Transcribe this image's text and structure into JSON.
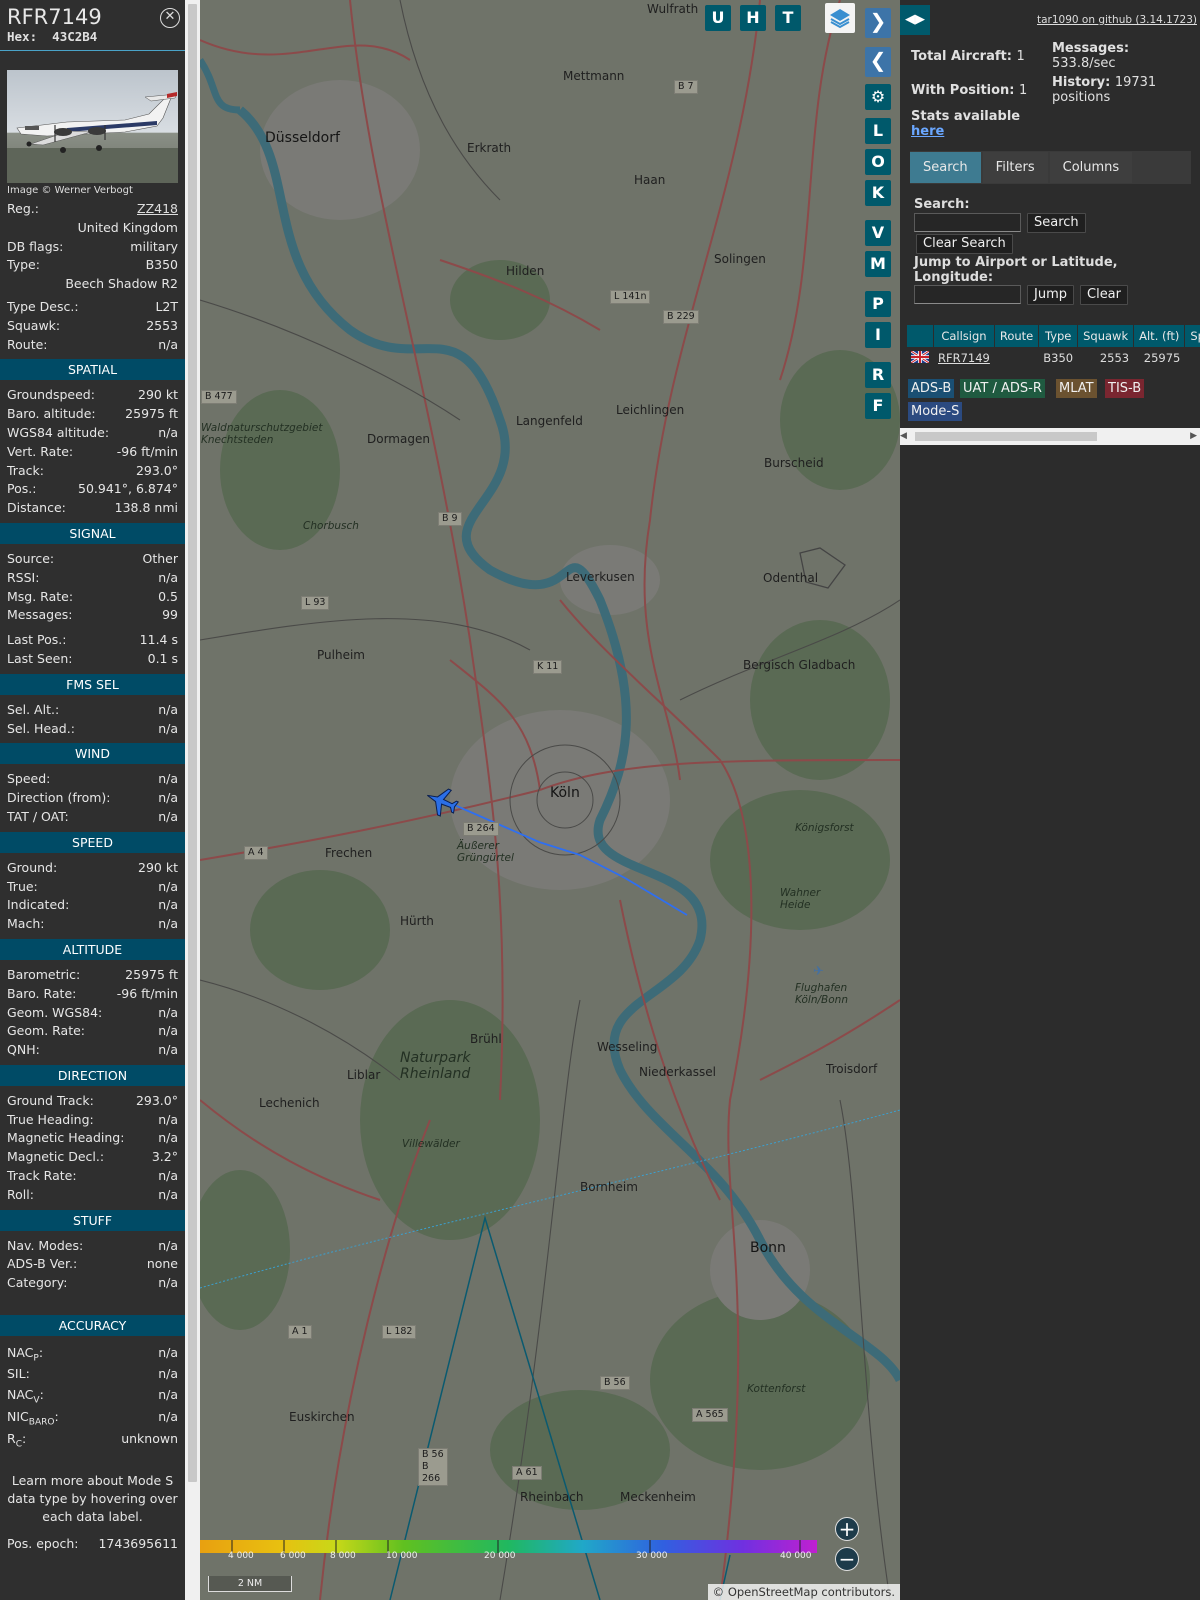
{
  "aircraft": {
    "callsign": "RFR7149",
    "hex_label": "Hex:",
    "hex": "43C2B4",
    "close_icon": "close-icon",
    "photo_credit": "Image © Werner Verbogt",
    "reg_label": "Reg.:",
    "reg": "ZZ418",
    "country": "United Kingdom",
    "dbflags_label": "DB flags:",
    "dbflags": "military",
    "type_label": "Type:",
    "type": "B350",
    "type_name": "Beech Shadow R2",
    "typedesc_label": "Type Desc.:",
    "typedesc": "L2T",
    "squawk_label": "Squawk:",
    "squawk": "2553",
    "route_label": "Route:",
    "route": "n/a"
  },
  "spatial": {
    "title": "SPATIAL",
    "rows": [
      {
        "label": "Groundspeed:",
        "value": "290 kt"
      },
      {
        "label": "Baro. altitude:",
        "value": "25975 ft"
      },
      {
        "label": "WGS84 altitude:",
        "value": "n/a"
      },
      {
        "label": "Vert. Rate:",
        "value": "-96 ft/min"
      },
      {
        "label": "Track:",
        "value": "293.0°"
      },
      {
        "label": "Pos.:",
        "value": "50.941°, 6.874°"
      },
      {
        "label": "Distance:",
        "value": "138.8 nmi"
      }
    ]
  },
  "signal": {
    "title": "SIGNAL",
    "rows": [
      {
        "label": "Source:",
        "value": "Other"
      },
      {
        "label": "RSSI:",
        "value": "n/a"
      },
      {
        "label": "Msg. Rate:",
        "value": "0.5"
      },
      {
        "label": "Messages:",
        "value": "99"
      }
    ],
    "rows2": [
      {
        "label": "Last Pos.:",
        "value": "11.4 s"
      },
      {
        "label": "Last Seen:",
        "value": "0.1 s"
      }
    ]
  },
  "fms": {
    "title": "FMS SEL",
    "rows": [
      {
        "label": "Sel. Alt.:",
        "value": "n/a"
      },
      {
        "label": "Sel. Head.:",
        "value": "n/a"
      }
    ]
  },
  "wind": {
    "title": "WIND",
    "rows": [
      {
        "label": "Speed:",
        "value": "n/a"
      },
      {
        "label": "Direction (from):",
        "value": "n/a"
      },
      {
        "label": "TAT / OAT:",
        "value": "n/a"
      }
    ]
  },
  "speed": {
    "title": "SPEED",
    "rows": [
      {
        "label": "Ground:",
        "value": "290 kt"
      },
      {
        "label": "True:",
        "value": "n/a"
      },
      {
        "label": "Indicated:",
        "value": "n/a"
      },
      {
        "label": "Mach:",
        "value": "n/a"
      }
    ]
  },
  "altitude": {
    "title": "ALTITUDE",
    "rows": [
      {
        "label": "Barometric:",
        "value": "25975 ft"
      },
      {
        "label": "Baro. Rate:",
        "value": "-96 ft/min"
      },
      {
        "label": "Geom. WGS84:",
        "value": "n/a"
      },
      {
        "label": "Geom. Rate:",
        "value": "n/a"
      },
      {
        "label": "QNH:",
        "value": "n/a"
      }
    ]
  },
  "direction": {
    "title": "DIRECTION",
    "rows": [
      {
        "label": "Ground Track:",
        "value": "293.0°"
      },
      {
        "label": "True Heading:",
        "value": "n/a"
      },
      {
        "label": "Magnetic Heading:",
        "value": "n/a"
      },
      {
        "label": "Magnetic Decl.:",
        "value": "3.2°"
      },
      {
        "label": "Track Rate:",
        "value": "n/a"
      },
      {
        "label": "Roll:",
        "value": "n/a"
      }
    ]
  },
  "stuff": {
    "title": "STUFF",
    "rows": [
      {
        "label": "Nav. Modes:",
        "value": "n/a"
      },
      {
        "label": "ADS-B Ver.:",
        "value": "none"
      },
      {
        "label": "Category:",
        "value": "n/a"
      }
    ]
  },
  "accuracy": {
    "title": "ACCURACY",
    "nacp_main": "NAC",
    "nacp_sub": "P",
    "nacp_value": "n/a",
    "sil_label": "SIL:",
    "sil_value": "n/a",
    "nacv_main": "NAC",
    "nacv_sub": "V",
    "nacv_value": "n/a",
    "nic_main": "NIC",
    "nic_sub": "BARO",
    "nic_value": "n/a",
    "rc_main": "R",
    "rc_sub": "C",
    "rc_value": "unknown",
    "colon": ":"
  },
  "footer_note": "Learn more about Mode S data type by hovering over each data label.",
  "epoch_label": "Pos. epoch:",
  "epoch_value": "1743695611",
  "map": {
    "cities": [
      {
        "name": "Düsseldorf"
      },
      {
        "name": "Köln"
      },
      {
        "name": "Leverkusen"
      },
      {
        "name": "Bonn"
      },
      {
        "name": "Solingen"
      },
      {
        "name": "Bergisch Gladbach"
      },
      {
        "name": "Dormagen"
      },
      {
        "name": "Hilden"
      },
      {
        "name": "Langenfeld"
      },
      {
        "name": "Leichlingen"
      },
      {
        "name": "Mettmann"
      },
      {
        "name": "Erkrath"
      },
      {
        "name": "Haan"
      },
      {
        "name": "Burscheid"
      },
      {
        "name": "Odenthal"
      },
      {
        "name": "Pulheim"
      },
      {
        "name": "Frechen"
      },
      {
        "name": "Hürth"
      },
      {
        "name": "Brühl"
      },
      {
        "name": "Wesseling"
      },
      {
        "name": "Niederkassel"
      },
      {
        "name": "Troisdorf"
      },
      {
        "name": "Liblar"
      },
      {
        "name": "Lechenich"
      },
      {
        "name": "Bornheim"
      },
      {
        "name": "Euskirchen"
      },
      {
        "name": "Rheinbach"
      },
      {
        "name": "Meckenheim"
      },
      {
        "name": "Wulfrath"
      },
      {
        "name": "Naturpark Rheinland"
      },
      {
        "name": "Waldnaturschutzgebiet Knechtsteden"
      },
      {
        "name": "Äußerer Grüngürtel"
      },
      {
        "name": "Königsforst"
      },
      {
        "name": "Wahner Heide"
      },
      {
        "name": "Flughafen Köln/Bonn"
      },
      {
        "name": "Kottenforst"
      },
      {
        "name": "Villewälder"
      },
      {
        "name": "Chorbusch"
      }
    ],
    "road_tags": [
      "B 7",
      "L 141n",
      "B 229",
      "B 477",
      "B 9",
      "L 93",
      "K 11",
      "B 264",
      "A 4",
      "A 1",
      "L 182",
      "B 56",
      "A 565",
      "B 56 B 266",
      "A 61"
    ],
    "toolbar": {
      "u": "U",
      "h": "H",
      "t": "T",
      "l": "L",
      "o": "O",
      "k": "K",
      "v": "V",
      "m": "M",
      "p": "P",
      "i": "I",
      "r": "R",
      "f": "F",
      "next_icon": "chevron-right-icon",
      "prev_icon": "chevron-left-icon",
      "settings_icon": "gear-icon",
      "layers_icon": "layers-icon"
    },
    "zoom_in": "+",
    "zoom_out": "−",
    "altitude_ticks": [
      "4 000",
      "6 000",
      "8 000",
      "10 000",
      "20 000",
      "30 000",
      "40 000"
    ],
    "scale_label": "2 NM",
    "attribution_prefix": "© ",
    "attribution_link": "OpenStreetMap",
    "attribution_suffix": " contributors."
  },
  "right_panel": {
    "toggle_icon": "expand-collapse-icon",
    "github_link": "tar1090 on github (3.14.1723)",
    "total_label": "Total Aircraft:",
    "total_value": "1",
    "position_label": "With Position:",
    "position_value": "1",
    "stats_label": "Stats available",
    "stats_link": "here",
    "messages_label": "Messages:",
    "messages_value": "533.8/sec",
    "history_label": "History:",
    "history_value": "19731",
    "history_unit": "positions",
    "tabs": [
      "Search",
      "Filters",
      "Columns"
    ],
    "search_label": "Search:",
    "search_button": "Search",
    "clear_search_button": "Clear Search",
    "jump_label": "Jump to Airport or Latitude, Longitude:",
    "jump_button": "Jump",
    "clear_button": "Clear",
    "table": {
      "headers": [
        "",
        "Callsign",
        "Route",
        "Type",
        "Squawk",
        "Alt. (ft)",
        "Spd"
      ],
      "rows": [
        {
          "flag_icon": "uk-flag-icon",
          "callsign": "RFR7149",
          "route": "",
          "type": "B350",
          "squawk": "2553",
          "alt": "25975"
        }
      ]
    },
    "source_tags": [
      {
        "label": "ADS-B",
        "color": "#1a4f73"
      },
      {
        "label": "UAT / ADS-R",
        "color": "#1f5a40"
      },
      {
        "label": "MLAT",
        "color": "#6b5230"
      },
      {
        "label": "TIS-B",
        "color": "#7a2630"
      },
      {
        "label": "Mode-S",
        "color": "#2b4a80"
      }
    ]
  }
}
